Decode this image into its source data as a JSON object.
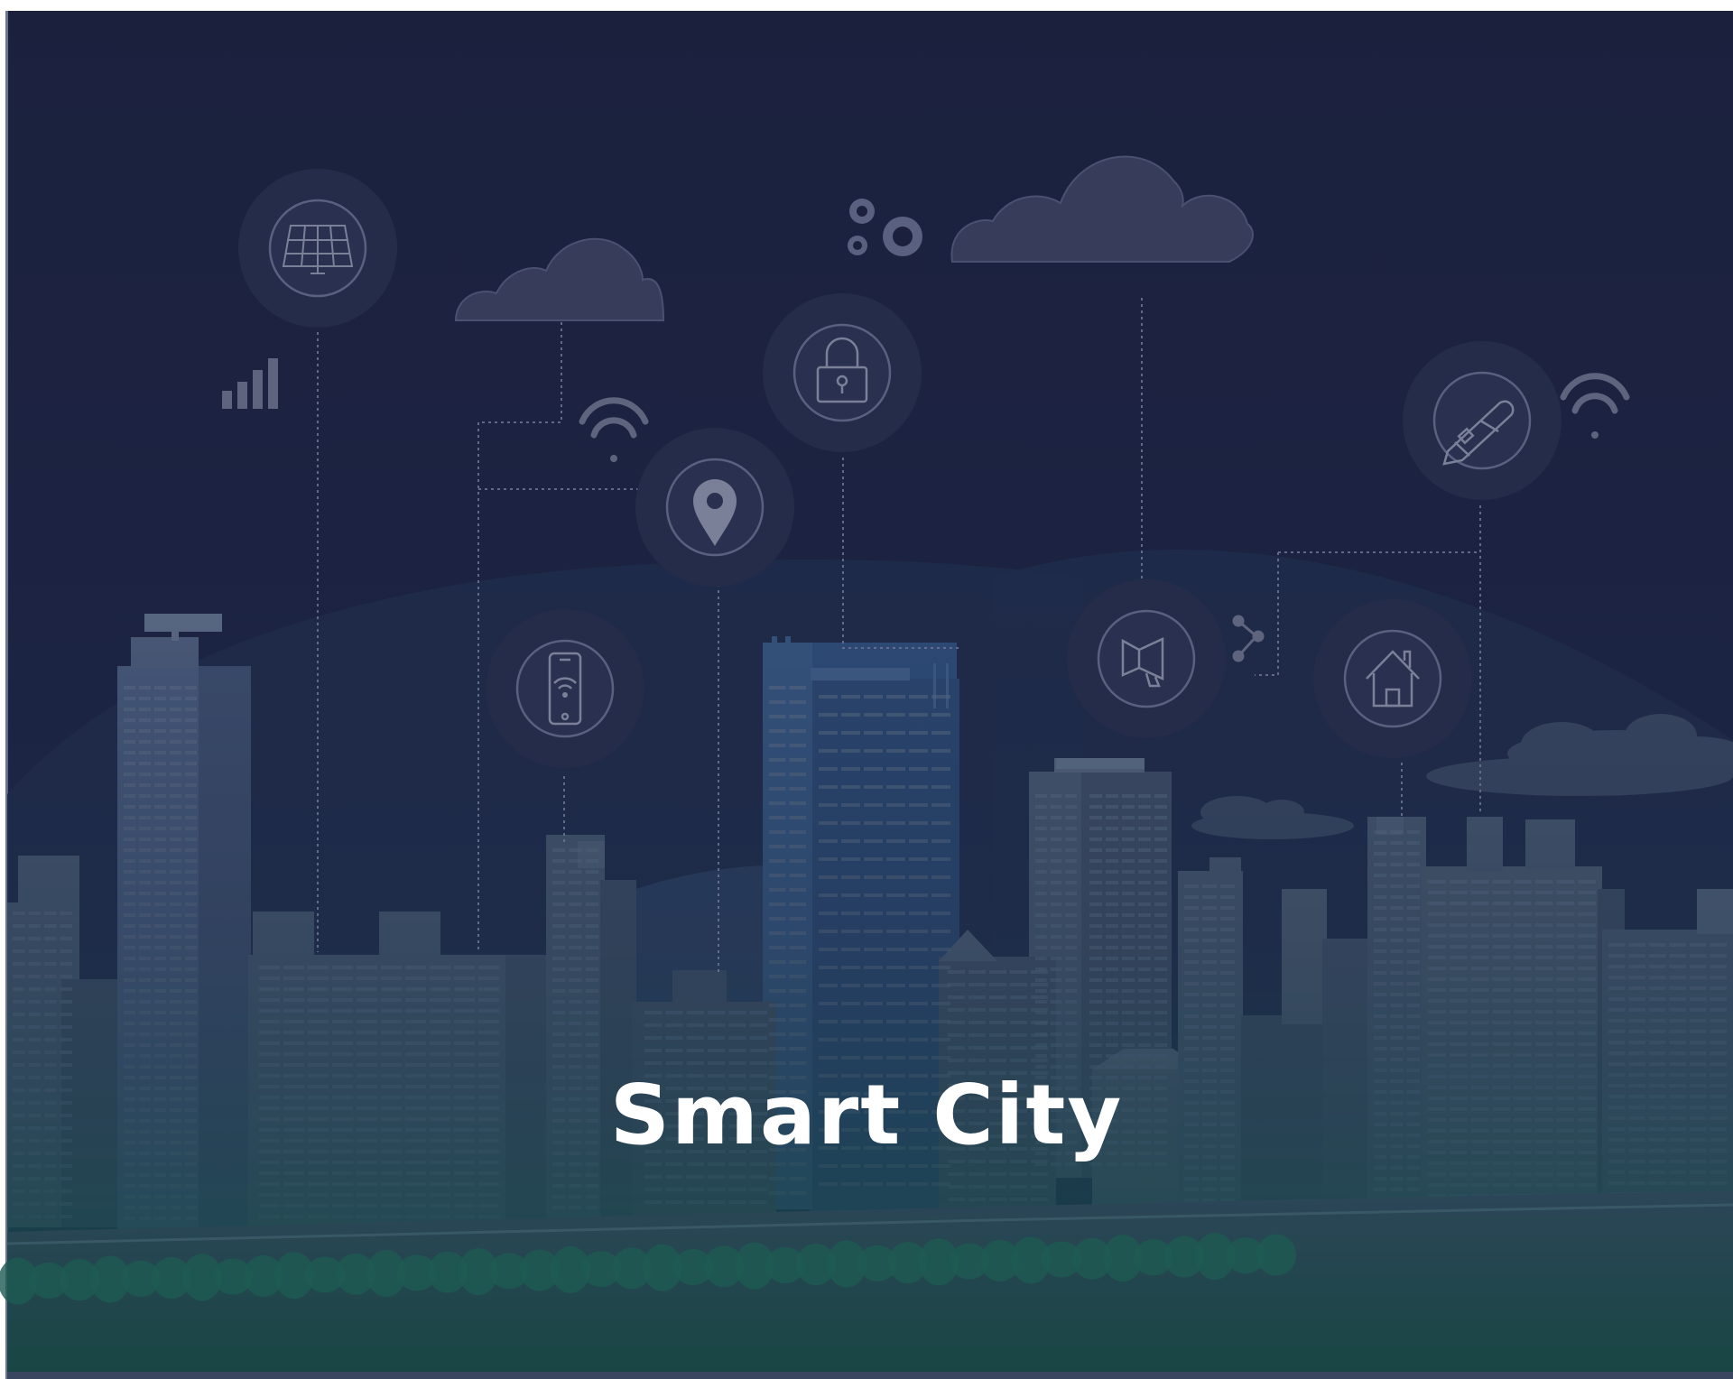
{
  "title": "Smart City",
  "colors": {
    "sky_top": "#1b213d",
    "sky_mid": "#1d2747",
    "hill": "#223150",
    "building_light": "#45566f",
    "building_dark": "#3a4a63",
    "building_blue": "#2a4a72",
    "ground_top": "#2c4a5a",
    "ground_bottom": "#1a4a4a",
    "trees": "#1e5a50",
    "icon_halo": "#252c49",
    "icon_ring": "#5a6080",
    "cloud": "#363b58",
    "dotted_line": "#6a7090",
    "title": "#ffffff"
  },
  "icons": [
    "solar-panel-icon",
    "lock-icon",
    "location-pin-icon",
    "smartphone-wifi-icon",
    "megaphone-icon",
    "smart-home-icon",
    "pen-icon",
    "signal-bars-icon",
    "wifi-icon",
    "gears-icon",
    "share-icon",
    "cloud-icon"
  ]
}
